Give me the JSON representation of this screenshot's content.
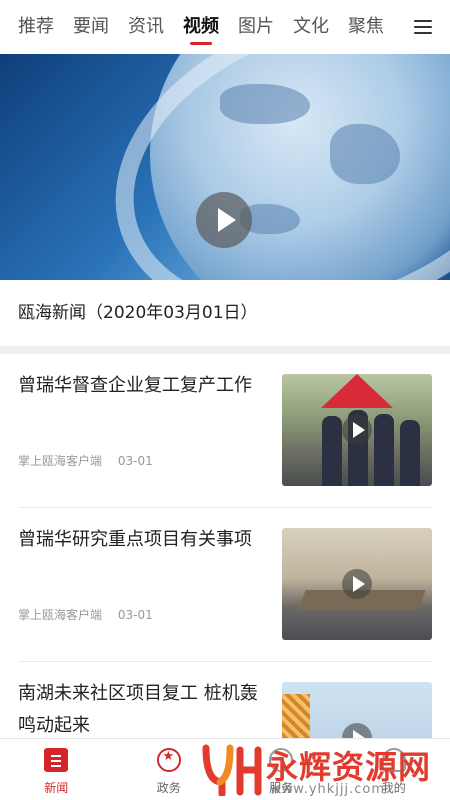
{
  "tabs": [
    {
      "label": "推荐",
      "active": false
    },
    {
      "label": "要闻",
      "active": false
    },
    {
      "label": "资讯",
      "active": false
    },
    {
      "label": "视频",
      "active": true
    },
    {
      "label": "图片",
      "active": false
    },
    {
      "label": "文化",
      "active": false
    },
    {
      "label": "聚焦",
      "active": false
    }
  ],
  "hero": {
    "caption": "瓯海新闻（2020年03月01日）"
  },
  "news": [
    {
      "title": "曾瑞华督查企业复工复产工作",
      "source": "掌上瓯海客户端",
      "date": "03-01"
    },
    {
      "title": "曾瑞华研究重点项目有关事项",
      "source": "掌上瓯海客户端",
      "date": "03-01"
    },
    {
      "title": "南湖未来社区项目复工 桩机轰鸣动起来",
      "source": "",
      "date": ""
    }
  ],
  "bottom_nav": [
    {
      "label": "新闻",
      "icon": "news-icon",
      "active": true
    },
    {
      "label": "政务",
      "icon": "gov-icon",
      "active": false
    },
    {
      "label": "服务",
      "icon": "service-icon",
      "active": false
    },
    {
      "label": "我的",
      "icon": "mine-icon",
      "active": false
    }
  ],
  "watermark": {
    "text": "永辉资源网",
    "url": "www.yhkjjj.com"
  },
  "colors": {
    "accent": "#d3262c"
  }
}
